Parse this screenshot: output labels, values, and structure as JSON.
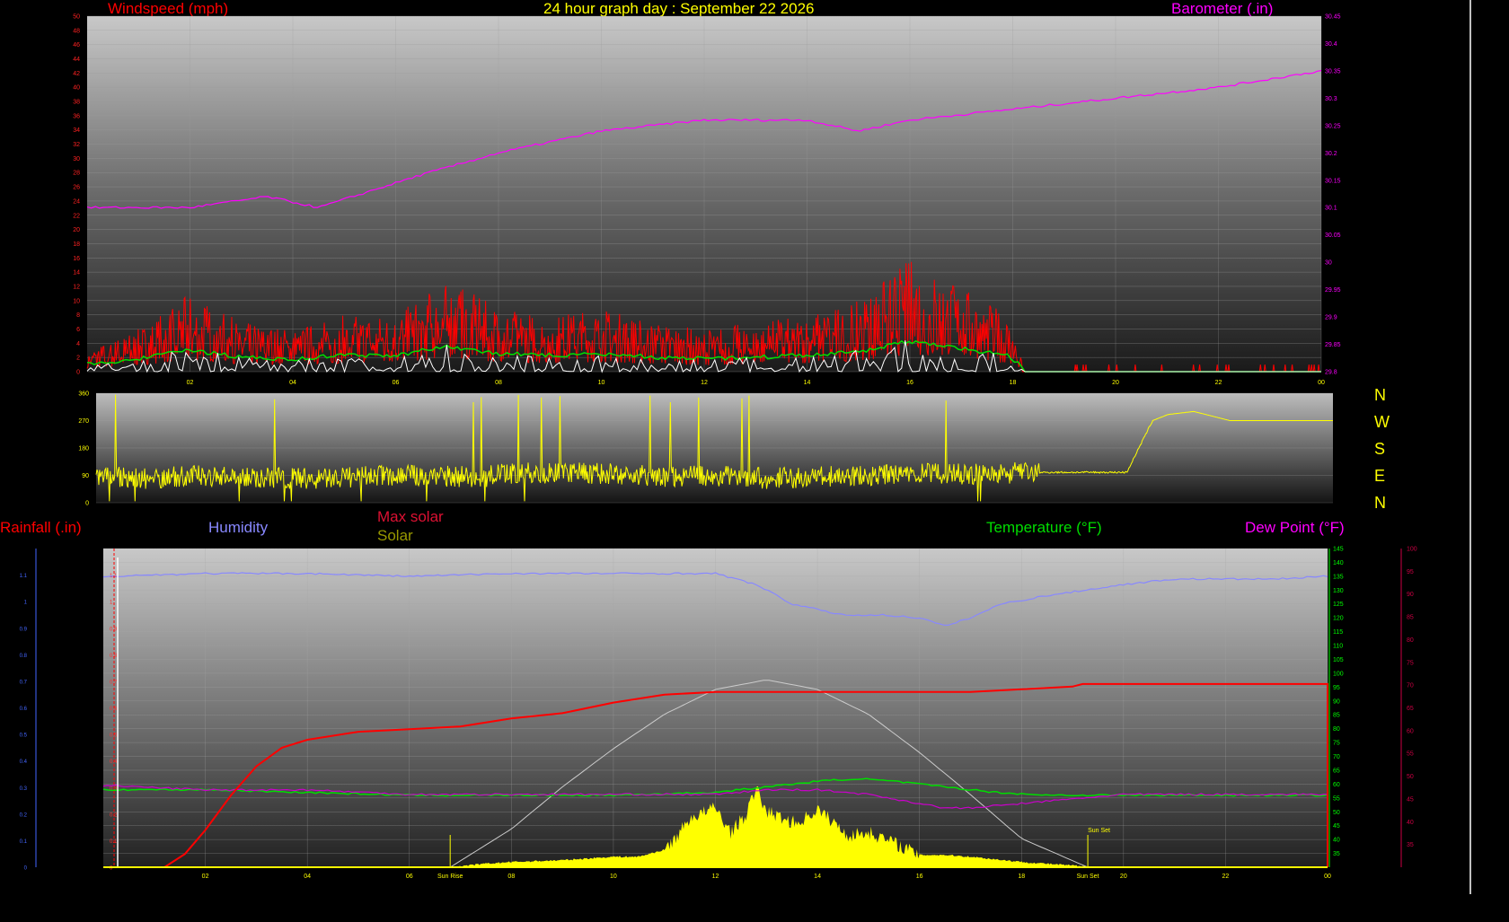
{
  "header": {
    "title": "24 hour graph day : September 22 2026",
    "title_color": "#ffff00",
    "windspeed_label": "Windspeed (mph)",
    "windspeed_color": "#ff0000",
    "barometer_label": "Barometer (.in)",
    "barometer_color": "#ff00ff"
  },
  "lower_labels": {
    "rainfall": "Rainfall (.in)",
    "humidity": "Humidity",
    "max_solar": "Max solar",
    "solar": "Solar",
    "temperature": "Temperature (°F)",
    "dew_point": "Dew Point (°F)",
    "sun_rise": "Sun Rise",
    "sun_set": "Sun Set"
  },
  "compass": [
    "N",
    "W",
    "S",
    "E",
    "N"
  ],
  "colors": {
    "windspeed": "#ff0000",
    "wind_avg": "#00e000",
    "wind_low": "#ffffff",
    "barometer": "#ff00ff",
    "direction": "#ffff00",
    "rainfall": "#ff0000",
    "humidity": "#8888ff",
    "max_solar": "#cccccc",
    "solar": "#ffff00",
    "temperature": "#00dd00",
    "dew_point": "#cc00cc",
    "rain_axis": "#4466ff",
    "temp_axis": "#00ff00",
    "dew_axis": "#cc0044"
  },
  "chart_data": [
    {
      "type": "line",
      "name": "wind-baro",
      "xlabel": "",
      "x_ticks": [
        "02",
        "04",
        "06",
        "08",
        "10",
        "12",
        "14",
        "16",
        "18",
        "20",
        "22",
        "00"
      ],
      "left_axis": {
        "label": "Windspeed (mph)",
        "range": [
          0,
          50
        ],
        "ticks": [
          "0",
          "2",
          "4",
          "6",
          "8",
          "10",
          "12",
          "14",
          "16",
          "18",
          "20",
          "22",
          "24",
          "26",
          "28",
          "30",
          "32",
          "34",
          "36",
          "38",
          "40",
          "42",
          "44",
          "46",
          "48",
          "50"
        ]
      },
      "right_axis": {
        "label": "Barometer (.in)",
        "range": [
          29.8,
          30.45
        ],
        "ticks": [
          "29.8",
          "29.85",
          "29.9",
          "29.95",
          "30",
          "30.05",
          "30.1",
          "30.15",
          "30.2",
          "30.25",
          "30.3",
          "30.35",
          "30.4",
          "30.45"
        ]
      },
      "barometer": {
        "x": [
          0,
          2,
          3.5,
          4.5,
          5.5,
          6.5,
          8,
          10,
          12,
          14,
          15,
          16,
          18,
          20,
          22,
          24
        ],
        "y": [
          30.1,
          30.1,
          30.12,
          30.1,
          30.13,
          30.16,
          30.2,
          30.24,
          30.26,
          30.26,
          30.24,
          30.26,
          30.28,
          30.3,
          30.32,
          30.35
        ]
      },
      "wind_activity": {
        "x": [
          0,
          1,
          2,
          3,
          4,
          5,
          6,
          7,
          8,
          9,
          10,
          11,
          12,
          13,
          14,
          15,
          16,
          17,
          17.9,
          18.2,
          20,
          22,
          24
        ],
        "peak_mph": [
          3,
          6,
          11,
          7,
          6,
          8,
          8,
          13,
          9,
          8,
          9,
          7,
          6,
          7,
          8,
          10,
          16,
          12,
          8,
          1,
          1,
          1,
          0
        ]
      }
    },
    {
      "type": "line",
      "name": "wind-direction",
      "x_ticks": [
        "02",
        "04",
        "06",
        "08",
        "10",
        "12",
        "14",
        "16",
        "18",
        "20",
        "22",
        "00"
      ],
      "y_ticks": [
        "0",
        "90",
        "180",
        "270",
        "360"
      ],
      "ylim": [
        0,
        360
      ],
      "x": [
        0,
        1,
        2,
        4,
        6,
        7.5,
        8,
        9,
        10,
        11,
        12,
        13,
        14,
        15,
        16,
        17,
        18.5,
        19,
        20,
        20.5,
        20.8,
        21.3,
        22,
        24
      ],
      "y": [
        90,
        80,
        90,
        80,
        90,
        85,
        95,
        100,
        95,
        85,
        90,
        80,
        85,
        90,
        95,
        95,
        100,
        100,
        100,
        270,
        290,
        300,
        270,
        270
      ]
    },
    {
      "type": "line",
      "name": "rain-humidity-solar-temp",
      "x_ticks": [
        "02",
        "04",
        "06",
        "08",
        "10",
        "12",
        "14",
        "16",
        "18",
        "20",
        "22",
        "00"
      ],
      "rain_axis": {
        "label": "Rainfall (.in)",
        "range": [
          0,
          1.2
        ],
        "ticks": [
          "0",
          "0.1",
          "0.2",
          "0.3",
          "0.4",
          "0.5",
          "0.6",
          "0.7",
          "0.8",
          "0.9",
          "1",
          "1.1"
        ]
      },
      "temp_axis": {
        "label": "Temperature (°F)",
        "range": [
          30,
          145
        ],
        "ticks": [
          "35",
          "40",
          "45",
          "50",
          "55",
          "60",
          "65",
          "70",
          "75",
          "80",
          "85",
          "90",
          "95",
          "100",
          "105",
          "110",
          "115",
          "120",
          "125",
          "130",
          "135",
          "140",
          "145"
        ]
      },
      "dew_axis": {
        "label": "Dew Point (°F)",
        "range": [
          30,
          100
        ],
        "ticks": [
          "35",
          "40",
          "45",
          "50",
          "55",
          "60",
          "65",
          "70",
          "75",
          "80",
          "85",
          "90",
          "95",
          "100"
        ]
      },
      "humidity": {
        "x": [
          0,
          2,
          4,
          6,
          8,
          10,
          12,
          12.8,
          13.5,
          14.5,
          15.3,
          16,
          16.5,
          17,
          17.6,
          18.5,
          20,
          21,
          22,
          23,
          24
        ],
        "y": [
          100,
          101,
          101,
          100,
          101,
          101,
          101,
          97,
          90,
          86,
          86,
          85,
          82,
          85,
          90,
          93,
          97,
          99,
          99,
          99,
          100
        ]
      },
      "rainfall": {
        "x": [
          0,
          1.2,
          1.6,
          2,
          2.5,
          3,
          3.5,
          4,
          5,
          6,
          7,
          8,
          9,
          10,
          11,
          12,
          13,
          14,
          15,
          17,
          18,
          19,
          19.2,
          20,
          24,
          24
        ],
        "y": [
          0,
          0,
          0.05,
          0.14,
          0.27,
          0.38,
          0.45,
          0.48,
          0.51,
          0.52,
          0.53,
          0.56,
          0.58,
          0.62,
          0.65,
          0.66,
          0.66,
          0.66,
          0.66,
          0.66,
          0.67,
          0.68,
          0.69,
          0.69,
          0.69,
          0
        ]
      },
      "max_solar": {
        "x": [
          6.8,
          8,
          9,
          10,
          11,
          12,
          13,
          14,
          15,
          16,
          17,
          18,
          19.3
        ],
        "y": [
          0,
          0.2,
          0.42,
          0.62,
          0.8,
          0.93,
          0.98,
          0.93,
          0.8,
          0.6,
          0.38,
          0.15,
          0
        ]
      },
      "solar": {
        "x": [
          6.8,
          7.5,
          8,
          9,
          10,
          10.5,
          11,
          11.2,
          11.5,
          12,
          12.3,
          12.6,
          12.8,
          13,
          13.3,
          13.6,
          14,
          14.3,
          14.6,
          15,
          15.5,
          16,
          16.5,
          17,
          18,
          19,
          19.3
        ],
        "y": [
          0,
          0.02,
          0.03,
          0.04,
          0.06,
          0.06,
          0.1,
          0.16,
          0.28,
          0.34,
          0.2,
          0.3,
          0.45,
          0.32,
          0.28,
          0.25,
          0.33,
          0.26,
          0.18,
          0.2,
          0.14,
          0.07,
          0.07,
          0.06,
          0.03,
          0.01,
          0
        ]
      },
      "temperature": {
        "x": [
          0,
          2,
          4,
          6,
          8,
          10,
          12,
          13,
          14,
          14.8,
          15.5,
          16.5,
          17.5,
          18.5,
          20,
          24
        ],
        "y": [
          58,
          58,
          57,
          56,
          56,
          56,
          57,
          59,
          61,
          62,
          61,
          59,
          57,
          56,
          56,
          56
        ]
      },
      "dew_point": {
        "x": [
          0,
          2,
          4,
          6,
          8,
          10,
          12,
          13,
          14,
          15,
          16,
          16.5,
          17,
          18,
          20,
          24
        ],
        "y": [
          48,
          47,
          47,
          46,
          46,
          46,
          46,
          47,
          47,
          46,
          44,
          43,
          43,
          44,
          46,
          46
        ]
      },
      "sunrise_x": 6.8,
      "sunset_x": 19.3
    }
  ]
}
